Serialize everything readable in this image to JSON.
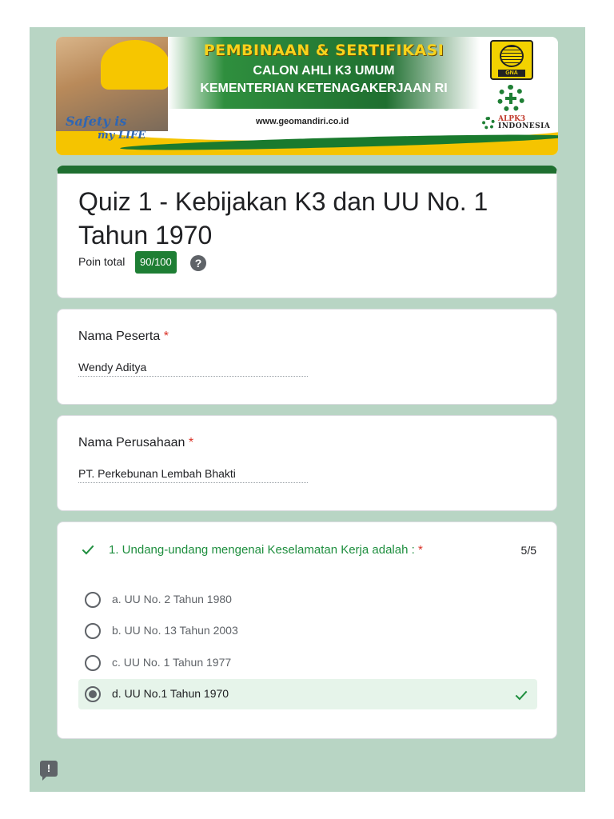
{
  "banner": {
    "title_line1": "PEMBINAAN & SERTIFIKASI",
    "title_line2": "CALON AHLI K3 UMUM",
    "title_line3": "KEMENTERIAN KETENAGAKERJAAN RI",
    "website": "www.geomandiri.co.id",
    "slogan_part1": "Safety is",
    "slogan_part2": "my LIFE",
    "logo_gna_text": "GNA",
    "alpk3_line1": "ALPK3",
    "alpk3_line2": "INDONESIA"
  },
  "quiz": {
    "title": "Quiz 1 - Kebijakan K3 dan UU No. 1 Tahun 1970",
    "points_label": "Poin total",
    "points_value": "90/100",
    "help_icon": "?"
  },
  "fields": {
    "name_label": "Nama Peserta",
    "name_value": "Wendy Aditya",
    "company_label": "Nama Perusahaan",
    "company_value": "PT. Perkebunan Lembah Bhakti",
    "required_mark": "*"
  },
  "question": {
    "text": "1. Undang-undang mengenai Keselamatan Kerja adalah :",
    "score": "5/5",
    "options": [
      {
        "label": "a. UU No. 2 Tahun 1980",
        "selected": false,
        "correct": false
      },
      {
        "label": "b. UU No. 13 Tahun 2003",
        "selected": false,
        "correct": false
      },
      {
        "label": "c. UU No. 1 Tahun 1977",
        "selected": false,
        "correct": false
      },
      {
        "label": "d. UU No.1 Tahun 1970",
        "selected": true,
        "correct": true
      }
    ]
  },
  "feedback_icon": "!",
  "colors": {
    "page_background": "#b8d5c4",
    "accent_green": "#1f6f30",
    "badge_green": "#1e7e34",
    "correct_text": "#1e8e3e",
    "correct_bg": "#e6f4ea",
    "required_red": "#d93025"
  }
}
